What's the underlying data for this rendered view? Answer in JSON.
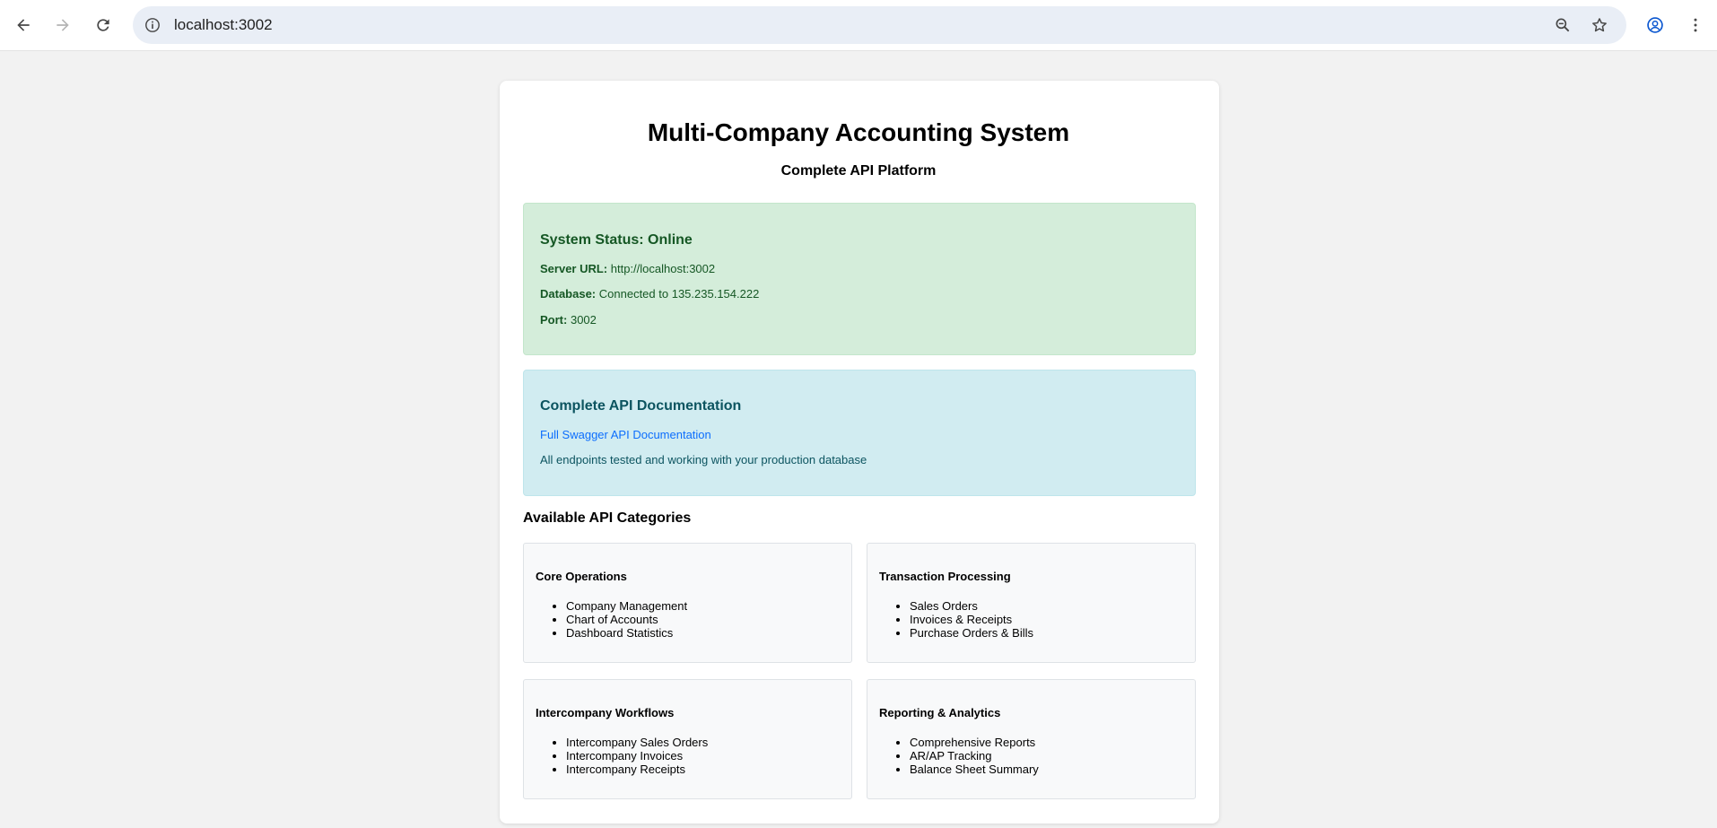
{
  "browser": {
    "url": "localhost:3002"
  },
  "page": {
    "title": "Multi-Company Accounting System",
    "subtitle": "Complete API Platform"
  },
  "status": {
    "heading": "System Status: Online",
    "server_label": "Server URL:",
    "server_value": "http://localhost:3002",
    "database_label": "Database:",
    "database_value": "Connected to 135.235.154.222",
    "port_label": "Port:",
    "port_value": "3002"
  },
  "docs": {
    "heading": "Complete API Documentation",
    "link_text": "Full Swagger API Documentation",
    "note": "All endpoints tested and working with your production database"
  },
  "categories_title": "Available API Categories",
  "categories": [
    {
      "title": "Core Operations",
      "items": [
        "Company Management",
        "Chart of Accounts",
        "Dashboard Statistics"
      ]
    },
    {
      "title": "Transaction Processing",
      "items": [
        "Sales Orders",
        "Invoices & Receipts",
        "Purchase Orders & Bills"
      ]
    },
    {
      "title": "Intercompany Workflows",
      "items": [
        "Intercompany Sales Orders",
        "Intercompany Invoices",
        "Intercompany Receipts"
      ]
    },
    {
      "title": "Reporting & Analytics",
      "items": [
        "Comprehensive Reports",
        "AR/AP Tracking",
        "Balance Sheet Summary"
      ]
    }
  ],
  "colors": {
    "status_bg": "#d4edda",
    "status_text": "#155724",
    "docs_bg": "#d1ecf1",
    "docs_text": "#0c5460",
    "link": "#0d6efd"
  }
}
